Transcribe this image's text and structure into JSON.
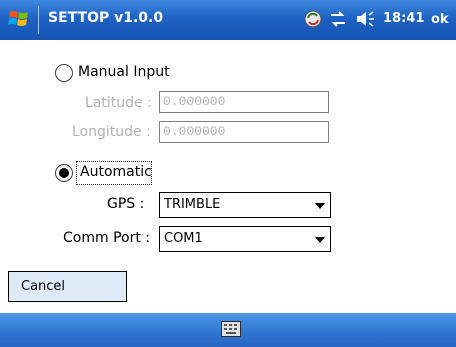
{
  "window": {
    "title": "SETTOP v1.0.0",
    "clock": "18:41",
    "ok_label": "ok",
    "icons": [
      "windows-start-flag-icon",
      "sync-icon",
      "connectivity-icon",
      "volume-icon"
    ]
  },
  "form": {
    "manual": {
      "label": "Manual Input",
      "selected": false,
      "latitude_label": "Latitude :",
      "latitude_value": "0.000000",
      "longitude_label": "Longitude :",
      "longitude_value": "0.000000"
    },
    "automatic": {
      "label": "Automatic",
      "selected": true,
      "gps_label": "GPS :",
      "gps_value": "TRIMBLE",
      "comm_port_label": "Comm Port :",
      "comm_port_value": "COM1"
    }
  },
  "buttons": {
    "cancel_label": "Cancel"
  },
  "bottom_bar": {
    "icons": [
      "keyboard-icon"
    ]
  },
  "colors": {
    "titlebar": "#1e62c4",
    "bottombar": "#2f74d0",
    "disabled_text": "#b3b3b3"
  }
}
